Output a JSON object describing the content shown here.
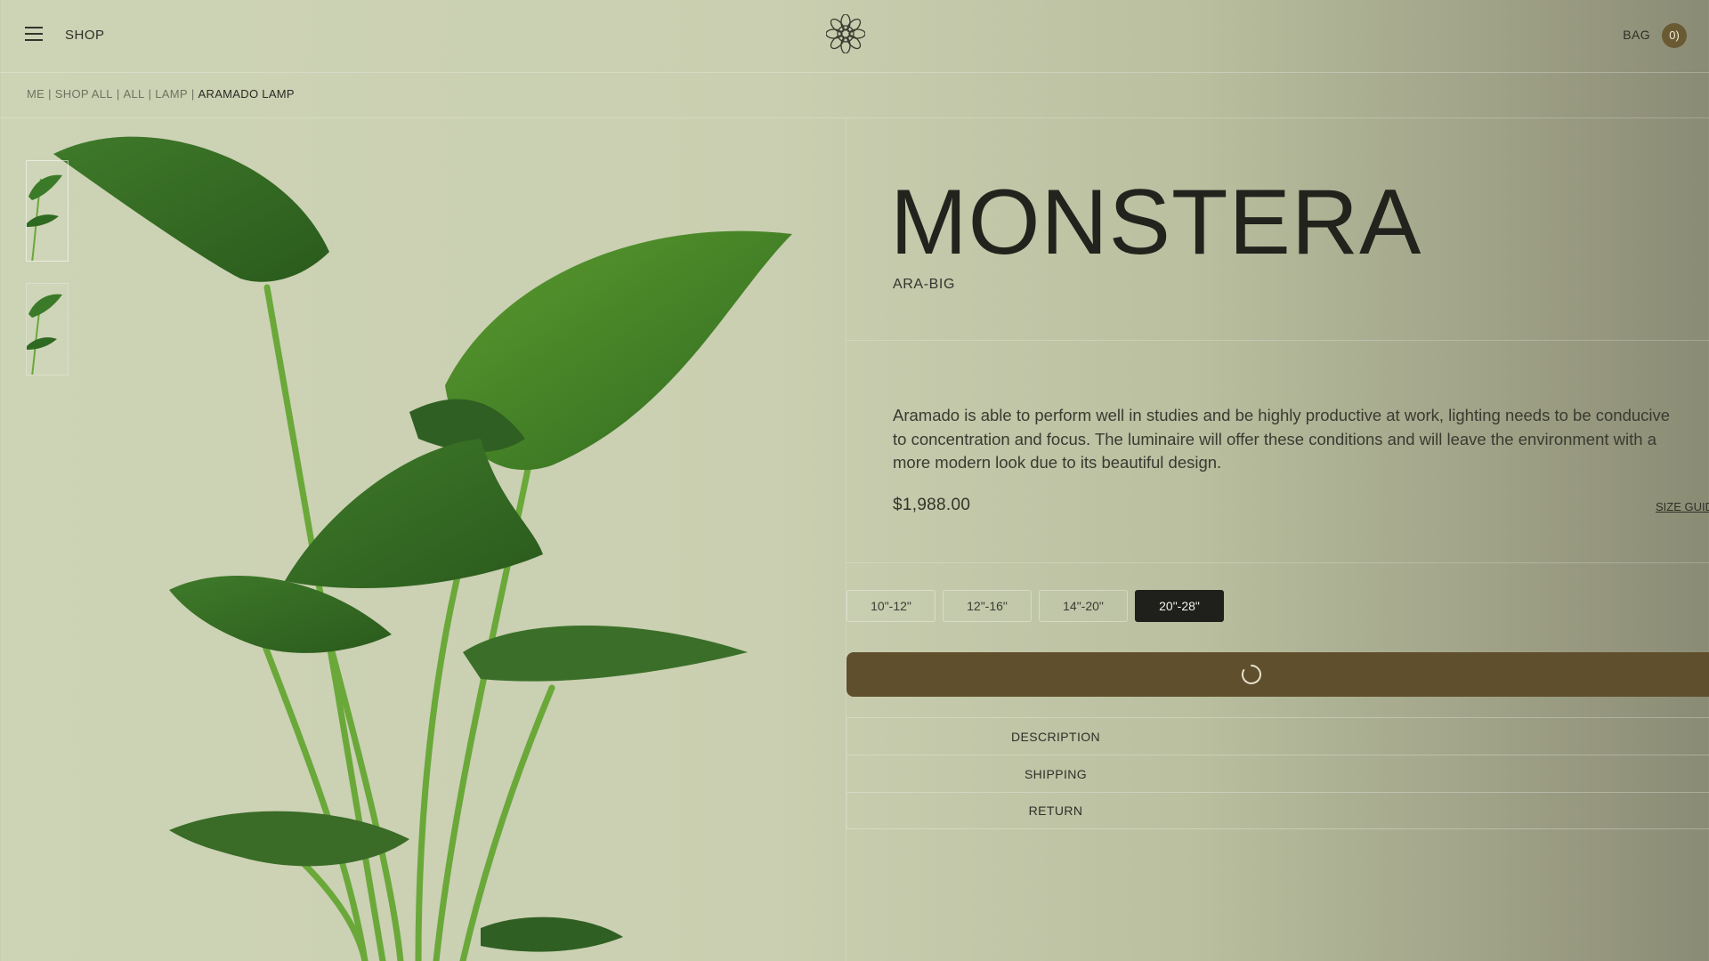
{
  "header": {
    "menu_icon": "hamburger-menu-icon",
    "shop_label": "SHOP",
    "logo_icon": "flower-mandala-logo-icon",
    "bag_label": "BAG",
    "bag_count": "0)"
  },
  "breadcrumb": {
    "items": [
      "ME",
      "SHOP ALL",
      "ALL",
      "LAMP"
    ],
    "current": "ARAMADO LAMP",
    "separator": "|"
  },
  "gallery": {
    "thumbnails": [
      "plant-thumbnail-1",
      "plant-thumbnail-2"
    ]
  },
  "product": {
    "title": "MONSTERA",
    "sku": "ARA-BIG",
    "description": "Aramado is able to perform well in studies and be highly productive at work, lighting needs to be conducive to concentration and focus. The luminaire will offer these conditions and will leave the environment with a more modern look due to its beautiful design.",
    "price": "$1,988.00",
    "size_guide_label": "SIZE GUIDE",
    "sizes": [
      "10\"-12\"",
      "12\"-16\"",
      "14\"-20\"",
      "20\"-28\""
    ],
    "selected_size_index": 3,
    "add_to_bag_state": "loading",
    "accordion": [
      "DESCRIPTION",
      "SHIPPING",
      "RETURN"
    ]
  },
  "colors": {
    "accent": "#5f4f2c",
    "selected_size_bg": "#1f201c",
    "badge": "#6a5a34"
  }
}
